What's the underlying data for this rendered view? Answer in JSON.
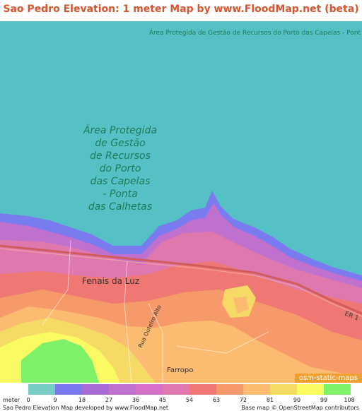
{
  "title": "Sao Pedro Elevation: 1 meter Map by www.FloodMap.net (beta)",
  "map": {
    "protected_area_label_top": "Área Protegida de Gestão de Recursos do Porto das Capelas - Pont",
    "protected_area_label_lines": [
      "Área Protegida",
      "de Gestão",
      "de Recursos",
      "do Porto",
      "das Capelas",
      "- Ponta",
      "das Calhetas"
    ],
    "places": {
      "fenais": "Fenais da Luz",
      "farropo": "Farropo"
    },
    "street": "Rua Outeiro Alto",
    "road_ref": "ER 1",
    "tile_attribution": "osm-static-maps",
    "tile_contrib": "© OpenStreetMap contributors",
    "colors": {
      "sea": "#55c1c6",
      "coast": "#7b7bf0",
      "accent": "#d9542c"
    }
  },
  "legend": {
    "unit": "meter",
    "ticks": [
      "0",
      "9",
      "18",
      "27",
      "36",
      "45",
      "54",
      "63",
      "72",
      "81",
      "90",
      "99",
      "108"
    ],
    "colors": [
      "#77ccc4",
      "#7a78ee",
      "#a86ad4",
      "#c070cd",
      "#d670c8",
      "#e078b0",
      "#f07874",
      "#f79a6a",
      "#fbbb70",
      "#f5da66",
      "#fafb62",
      "#7ff06a",
      "#7ad670"
    ]
  },
  "footer": {
    "left": "Sao Pedro Elevation Map developed by www.FloodMap.net",
    "right": "Base map © OpenStreetMap contributors"
  }
}
